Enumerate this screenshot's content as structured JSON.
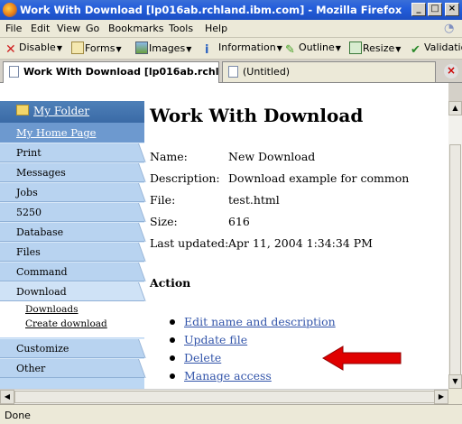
{
  "window": {
    "title": "Work With Download [lp016ab.rchland.ibm.com] - Mozilla Firefox",
    "minimize": "_",
    "maximize": "□",
    "close": "×"
  },
  "menu": {
    "items": [
      "File",
      "Edit",
      "View",
      "Go",
      "Bookmarks",
      "Tools",
      "Help"
    ]
  },
  "toolbar": {
    "items": [
      {
        "label": "Disable",
        "icon": "disable-icon"
      },
      {
        "label": "Forms",
        "icon": "forms-icon"
      },
      {
        "label": "Images",
        "icon": "images-icon"
      },
      {
        "label": "Information",
        "icon": "information-icon"
      },
      {
        "label": "Outline",
        "icon": "outline-icon"
      },
      {
        "label": "Resize",
        "icon": "resize-icon"
      },
      {
        "label": "Validation",
        "icon": "validation-icon"
      }
    ]
  },
  "tabs": [
    {
      "label": "Work With Download [lp016ab.rchl...",
      "active": true
    },
    {
      "label": "(Untitled)",
      "active": false
    }
  ],
  "sidebar": {
    "folder_link": "My Folder",
    "home_link": "My Home Page",
    "items": [
      "Print",
      "Messages",
      "Jobs",
      "5250",
      "Database",
      "Files",
      "Command",
      "Download"
    ],
    "subitems": [
      "Downloads",
      "Create download"
    ],
    "items_after": [
      "Customize",
      "Other"
    ]
  },
  "main": {
    "title": "Work With Download",
    "fields": [
      {
        "label": "Name:",
        "value": "New Download"
      },
      {
        "label": "Description:",
        "value": "Download example for common"
      },
      {
        "label": "File:",
        "value": "test.html"
      },
      {
        "label": "Size:",
        "value": "616"
      },
      {
        "label": "Last updated:",
        "value": "Apr 11, 2004 1:34:34 PM"
      }
    ],
    "action_header": "Action",
    "actions": [
      "Edit name and description",
      "Update file",
      "Delete",
      "Manage access"
    ]
  },
  "status": {
    "text": "Done"
  },
  "colors": {
    "titlebar": "#245edb",
    "sidebar": "#b8d3f0",
    "link": "#3355aa",
    "arrow": "#e00000"
  }
}
